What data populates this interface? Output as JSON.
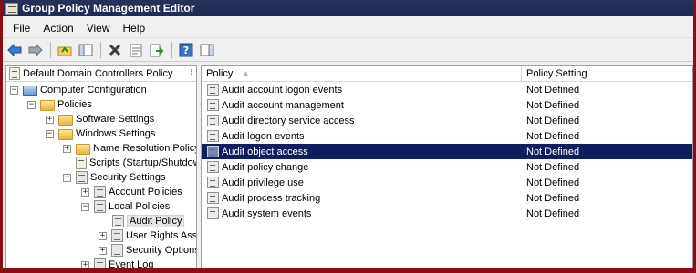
{
  "window": {
    "title": "Group Policy Management Editor"
  },
  "menu": {
    "items": [
      "File",
      "Action",
      "View",
      "Help"
    ]
  },
  "toolbar": {
    "icons": [
      "back-arrow-icon",
      "forward-arrow-icon",
      "up-folder-icon",
      "show-hide-tree-icon",
      "delete-icon",
      "properties-icon",
      "export-list-icon",
      "help-icon",
      "show-action-pane-icon"
    ]
  },
  "tree": {
    "header": "Default Domain Controllers Policy",
    "nodes": [
      {
        "label": "Computer Configuration",
        "expander": "−",
        "icon": "computer"
      },
      {
        "label": "Policies",
        "expander": "−",
        "icon": "folder"
      },
      {
        "label": "Software Settings",
        "expander": "+",
        "icon": "folder"
      },
      {
        "label": "Windows Settings",
        "expander": "−",
        "icon": "folder"
      },
      {
        "label": "Name Resolution Policy",
        "expander": "+",
        "icon": "folder"
      },
      {
        "label": "Scripts (Startup/Shutdown)",
        "expander": "",
        "icon": "scroll"
      },
      {
        "label": "Security Settings",
        "expander": "−",
        "icon": "policy"
      },
      {
        "label": "Account Policies",
        "expander": "+",
        "icon": "policy"
      },
      {
        "label": "Local Policies",
        "expander": "−",
        "icon": "policy"
      },
      {
        "label": "Audit Policy",
        "expander": "",
        "icon": "policy",
        "selected": true
      },
      {
        "label": "User Rights Assignment",
        "expander": "+",
        "icon": "policy"
      },
      {
        "label": "Security Options",
        "expander": "+",
        "icon": "policy"
      },
      {
        "label": "Event Log",
        "expander": "+",
        "icon": "policy"
      }
    ]
  },
  "list": {
    "columns": [
      "Policy",
      "Policy Setting"
    ],
    "rows": [
      {
        "policy": "Audit account logon events",
        "setting": "Not Defined"
      },
      {
        "policy": "Audit account management",
        "setting": "Not Defined"
      },
      {
        "policy": "Audit directory service access",
        "setting": "Not Defined"
      },
      {
        "policy": "Audit logon events",
        "setting": "Not Defined"
      },
      {
        "policy": "Audit object access",
        "setting": "Not Defined",
        "selected": true
      },
      {
        "policy": "Audit policy change",
        "setting": "Not Defined"
      },
      {
        "policy": "Audit privilege use",
        "setting": "Not Defined"
      },
      {
        "policy": "Audit process tracking",
        "setting": "Not Defined"
      },
      {
        "policy": "Audit system events",
        "setting": "Not Defined"
      }
    ]
  },
  "colors": {
    "titlebar": "#1e2a55",
    "selection": "#0d1f5e",
    "frame": "#8b0c18"
  }
}
